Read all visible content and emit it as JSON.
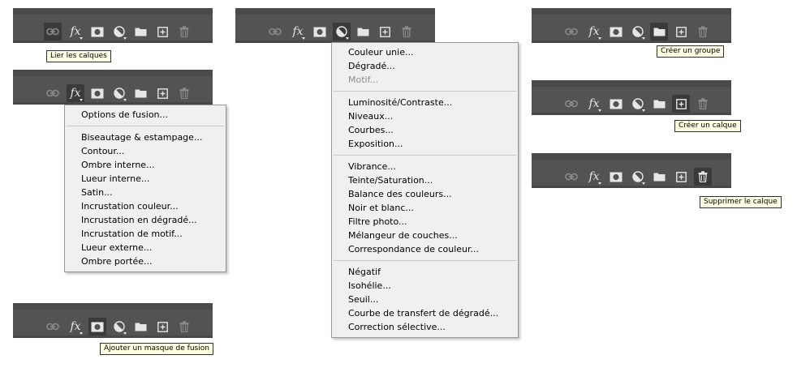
{
  "tooltips": {
    "link": "Lier les calques",
    "mask": "Ajouter un masque de fusion",
    "group": "Créer un groupe",
    "new_layer": "Créer un calque",
    "delete": "Supprimer le calque"
  },
  "icons": [
    "link-icon",
    "fx-icon",
    "mask-icon",
    "adjustment-icon",
    "folder-icon",
    "new-layer-icon",
    "trash-icon"
  ],
  "fx_label": "fx",
  "fx_menu": {
    "groups": [
      [
        "Options de fusion..."
      ],
      [
        "Biseautage & estampage...",
        "Contour...",
        "Ombre interne...",
        "Lueur interne...",
        "Satin...",
        "Incrustation couleur...",
        "Incrustation en dégradé...",
        "Incrustation de motif...",
        "Lueur externe...",
        "Ombre portée..."
      ]
    ]
  },
  "adjust_menu": {
    "groups": [
      [
        "Couleur unie...",
        "Dégradé...",
        "Motif..."
      ],
      [
        "Luminosité/Contraste...",
        "Niveaux...",
        "Courbes...",
        "Exposition..."
      ],
      [
        "Vibrance...",
        "Teinte/Saturation...",
        "Balance des couleurs...",
        "Noir et blanc...",
        "Filtre photo...",
        "Mélangeur de couches...",
        "Correspondance de couleur..."
      ],
      [
        "Négatif",
        "Isohélie...",
        "Seuil...",
        "Courbe de transfert de dégradé...",
        "Correction sélective..."
      ]
    ],
    "disabled": [
      "Motif..."
    ]
  }
}
